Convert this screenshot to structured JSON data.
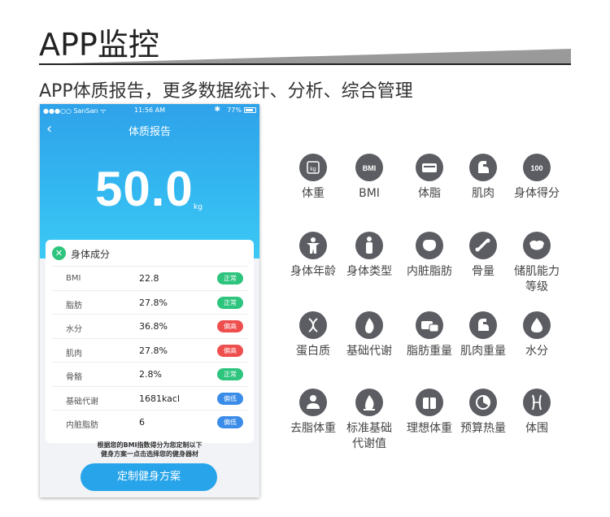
{
  "header": {
    "title": "APP监控",
    "subtitle": "APP体质报告，更多数据统计、分析、综合管理"
  },
  "phone": {
    "status": {
      "carrier": "●●●○○ SanSan ᯤ",
      "time": "11:56 AM",
      "battery": "77%",
      "bluetooth": "✱"
    },
    "nav": {
      "back": "‹",
      "title": "体质报告"
    },
    "score": {
      "value": "50.0",
      "unit": "kg"
    },
    "card": {
      "title": "身体成分",
      "rows": [
        {
          "name": "BMI",
          "value": "22.8",
          "status": "正常",
          "color": "#2dc47d"
        },
        {
          "name": "脂肪",
          "value": "27.8%",
          "status": "正常",
          "color": "#2dc47d"
        },
        {
          "name": "水分",
          "value": "36.8%",
          "status": "偏高",
          "color": "#ef4e4e"
        },
        {
          "name": "肌肉",
          "value": "27.8%",
          "status": "偏高",
          "color": "#ef4e4e"
        },
        {
          "name": "骨骼",
          "value": "2.8%",
          "status": "正常",
          "color": "#2dc47d"
        },
        {
          "name": "基础代谢",
          "value": "1681kacl",
          "status": "偏低",
          "color": "#3a8ce8"
        },
        {
          "name": "内脏脂肪",
          "value": "6",
          "status": "偏低",
          "color": "#3a8ce8"
        }
      ]
    },
    "note_line1": "根据您的BMI指数得分为您定制以下",
    "note_line2": "健身方案一点击选择您的健身器材",
    "cta": "定制健身方案"
  },
  "features": [
    {
      "label": "体重",
      "icon": "scale-icon",
      "glyph": "kg"
    },
    {
      "label": "BMI",
      "icon": "bmi-icon",
      "glyph": "BMI"
    },
    {
      "label": "体脂",
      "icon": "body-fat-icon",
      "glyph": ""
    },
    {
      "label": "肌肉",
      "icon": "muscle-icon",
      "glyph": ""
    },
    {
      "label": "身体得分",
      "icon": "score-icon",
      "glyph": "100"
    },
    {
      "label": "身体年龄",
      "icon": "body-age-icon",
      "glyph": ""
    },
    {
      "label": "身体类型",
      "icon": "body-type-icon",
      "glyph": ""
    },
    {
      "label": "内脏脂肪",
      "icon": "visceral-fat-icon",
      "glyph": ""
    },
    {
      "label": "骨量",
      "icon": "bone-icon",
      "glyph": ""
    },
    {
      "label": "储肌能力等级",
      "line1": "储肌能力",
      "line2": "等级",
      "icon": "muscle-level-icon",
      "glyph": ""
    },
    {
      "label": "蛋白质",
      "icon": "protein-icon",
      "glyph": ""
    },
    {
      "label": "基础代谢",
      "icon": "metabolism-icon",
      "glyph": ""
    },
    {
      "label": "脂肪重量",
      "icon": "fat-weight-icon",
      "glyph": ""
    },
    {
      "label": "肌肉重量",
      "icon": "muscle-weight-icon",
      "glyph": ""
    },
    {
      "label": "水分",
      "icon": "water-icon",
      "glyph": ""
    },
    {
      "label": "去脂体重",
      "icon": "lean-mass-icon",
      "glyph": ""
    },
    {
      "label": "标准基础代谢值",
      "line1": "标准基础",
      "line2": "代谢值",
      "icon": "standard-metabolism-icon",
      "glyph": ""
    },
    {
      "label": "理想体重",
      "icon": "ideal-weight-icon",
      "glyph": ""
    },
    {
      "label": "预算热量",
      "icon": "calorie-budget-icon",
      "glyph": ""
    },
    {
      "label": "体围",
      "icon": "body-measure-icon",
      "glyph": ""
    }
  ]
}
